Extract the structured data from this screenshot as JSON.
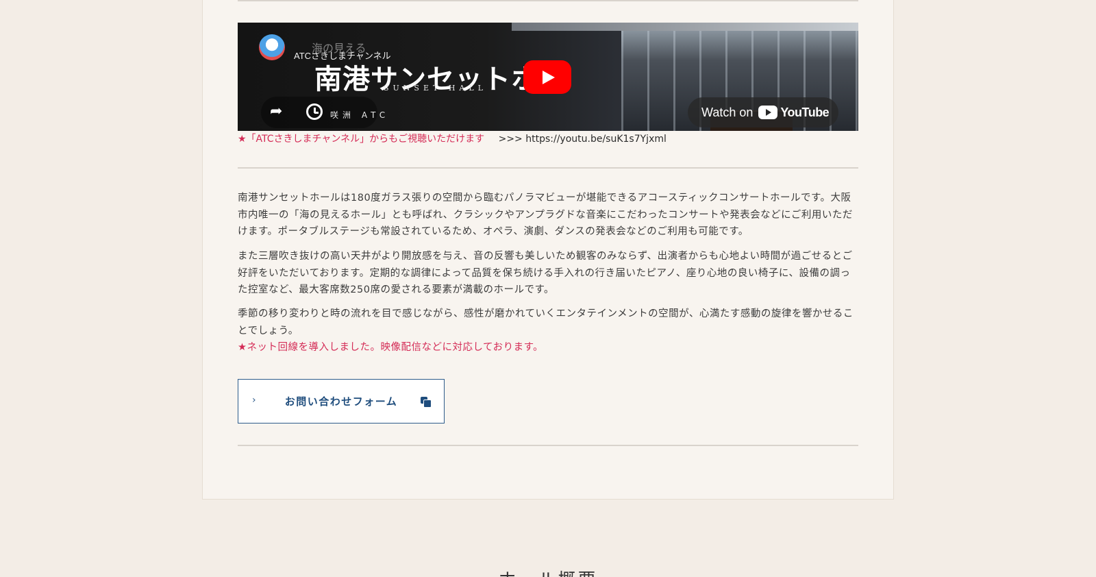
{
  "video": {
    "channel_name": "ATCさきしまチャンネル",
    "overlay_subtitle": "海の見える",
    "overlay_title": "南港サンセットホー",
    "overlay_en": "SUNSET HALL",
    "overlay_atc": "咲洲 ATC",
    "watch_on_label": "Watch on",
    "youtube_label": "YouTube"
  },
  "channel_note": {
    "text": "★「ATCさきしまチャンネル」からもご視聴いただけます",
    "url_text": ">>> https://youtu.be/suK1s7Yjxml"
  },
  "description": {
    "p1": "南港サンセットホールは180度ガラス張りの空間から臨むパノラマビューが堪能できるアコースティックコンサートホールです。大阪市内唯一の「海の見えるホール」とも呼ばれ、クラシックやアンプラグドな音楽にこだわったコンサートや発表会などにご利用いただけます。ポータブルステージも常設されているため、オペラ、演劇、ダンスの発表会などのご利用も可能です。",
    "p2": "また三層吹き抜けの高い天井がより開放感を与え、音の反響も美しいため観客のみならず、出演者からも心地よい時間が過ごせるとご好評をいただいております。定期的な調律によって品質を保ち続ける手入れの行き届いたピアノ、座り心地の良い椅子に、設備の調った控室など、最大客席数250席の愛される要素が満載のホールです。",
    "p3": "季節の移り変わりと時の流れを目で感じながら、感性が磨かれていくエンタテインメントの空間が、心満たす感動の旋律を響かせることでしょう。",
    "note": "★ネット回線を導入しました。映像配信などに対応しております。"
  },
  "contact": {
    "label": "お問い合わせフォーム"
  },
  "next_section": {
    "heading": "ホール概要"
  },
  "colors": {
    "accent_red": "#d42b56",
    "link_blue": "#1f4d7d",
    "background": "#f3ede6"
  }
}
